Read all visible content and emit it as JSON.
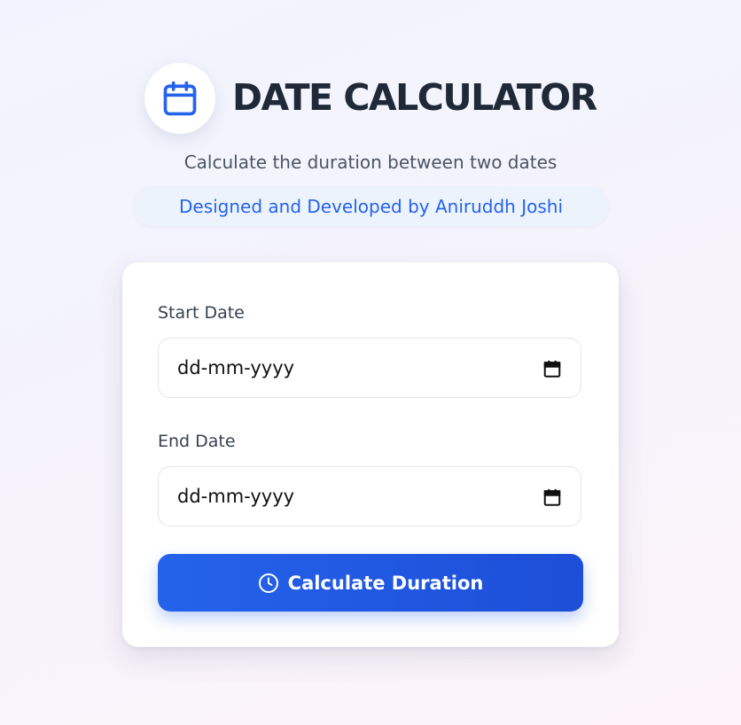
{
  "header": {
    "icon": "calendar-icon",
    "title": "DATE CALCULATOR",
    "subtitle": "Calculate the duration between two dates",
    "credit": "Designed and Developed by Aniruddh Joshi"
  },
  "form": {
    "start_date": {
      "label": "Start Date",
      "value": "dd-mm-yyyy",
      "picker_icon": "calendar-icon"
    },
    "end_date": {
      "label": "End Date",
      "value": "dd-mm-yyyy",
      "picker_icon": "calendar-icon"
    },
    "submit": {
      "label": "Calculate Duration",
      "icon": "clock-icon"
    }
  },
  "colors": {
    "accent": "#2563eb",
    "title": "#1f2937",
    "card": "#ffffff"
  }
}
